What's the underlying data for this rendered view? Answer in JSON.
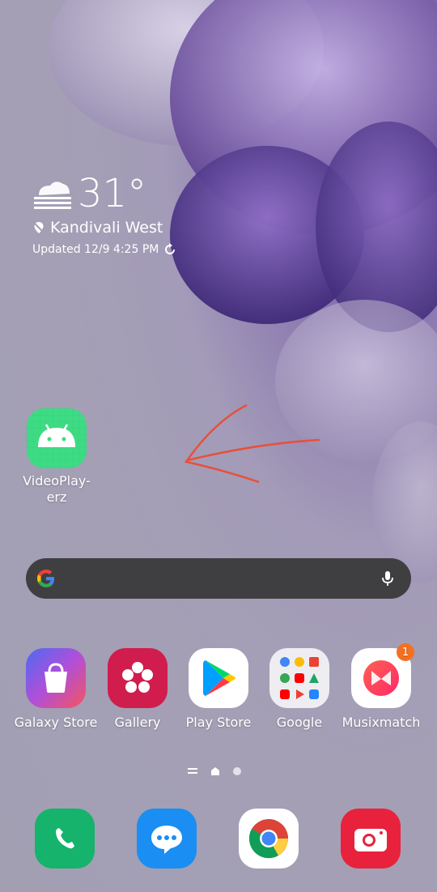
{
  "weather": {
    "temperature": "31°",
    "location": "Kandivali West",
    "updated": "Updated 12/9 4:25 PM",
    "icon": "fog-cloud-icon"
  },
  "desktop_app": {
    "label_line1": "VideoPlay-",
    "label_line2": "erz",
    "icon": "android-icon",
    "color": "#3ddc84"
  },
  "search": {
    "google_icon": "google-g-icon",
    "mic_icon": "mic-icon"
  },
  "apps": [
    {
      "label": "Galaxy Store",
      "icon": "shopping-bag-icon"
    },
    {
      "label": "Gallery",
      "icon": "flower-icon"
    },
    {
      "label": "Play Store",
      "icon": "play-triangle-icon"
    },
    {
      "label": "Google",
      "icon": "google-folder-icon"
    },
    {
      "label": "Musixmatch",
      "icon": "musixmatch-icon",
      "badge": "1"
    }
  ],
  "dock": [
    {
      "icon": "phone-icon"
    },
    {
      "icon": "messages-icon"
    },
    {
      "icon": "chrome-icon"
    },
    {
      "icon": "camera-icon"
    }
  ],
  "colors": {
    "accent_badge": "#f37021",
    "annotation_arrow": "#e8503a"
  }
}
